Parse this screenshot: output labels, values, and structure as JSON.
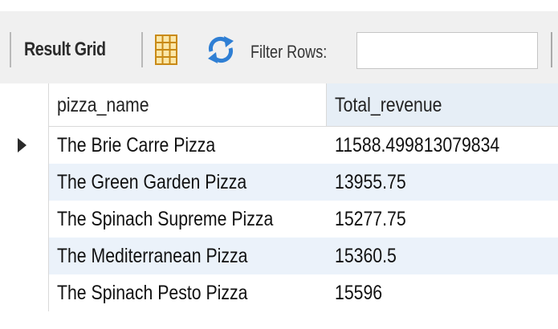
{
  "toolbar": {
    "result_grid_label": "Result Grid",
    "filter_label": "Filter Rows:",
    "filter_value": "",
    "icons": [
      "grid-layout-icon",
      "refresh-icon"
    ]
  },
  "table": {
    "columns": [
      "pizza_name",
      "Total_revenue"
    ],
    "rows": [
      {
        "pizza_name": "The Brie Carre Pizza",
        "total_revenue": "11588.499813079834"
      },
      {
        "pizza_name": "The Green Garden Pizza",
        "total_revenue": "13955.75"
      },
      {
        "pizza_name": "The Spinach Supreme Pizza",
        "total_revenue": "15277.75"
      },
      {
        "pizza_name": "The Mediterranean Pizza",
        "total_revenue": "15360.5"
      },
      {
        "pizza_name": "The Spinach Pesto Pizza",
        "total_revenue": "15596"
      }
    ],
    "selected_row": 0
  },
  "colors": {
    "toolbar_bg": "#f0f0f0",
    "alt_row_bg": "#ebf2fa",
    "header_active_bg": "#e6eef6"
  }
}
